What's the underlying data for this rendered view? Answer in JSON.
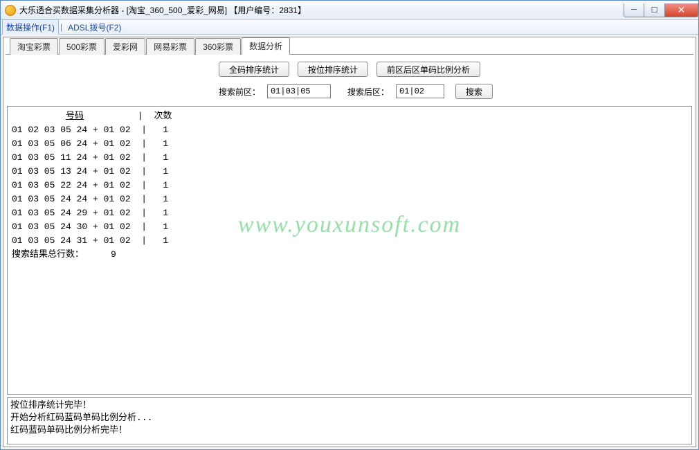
{
  "window": {
    "title": "大乐透合买数据采集分析器 - [淘宝_360_500_爱彩_网易]        【用户编号：2831】"
  },
  "menu": {
    "data_ops": "数据操作(F1)",
    "adsl": "ADSL拨号(F2)"
  },
  "tabs": {
    "taobao": "淘宝彩票",
    "c500": "500彩票",
    "aicai": "爱彩网",
    "wangyi": "网易彩票",
    "c360": "360彩票",
    "analysis": "数据分析"
  },
  "buttons": {
    "full_sort": "全码排序统计",
    "pos_sort": "按位排序统计",
    "ratio": "前区后区单码比例分析",
    "search": "搜索"
  },
  "labels": {
    "front": "搜索前区：",
    "back": "搜索后区："
  },
  "inputs": {
    "front": "01|03|05",
    "back": "01|02"
  },
  "headers": {
    "number": "号码",
    "count": "次数"
  },
  "rows": [
    {
      "code": "01 02 03 05 24 + 01 02",
      "count": "1"
    },
    {
      "code": "01 03 05 06 24 + 01 02",
      "count": "1"
    },
    {
      "code": "01 03 05 11 24 + 01 02",
      "count": "1"
    },
    {
      "code": "01 03 05 13 24 + 01 02",
      "count": "1"
    },
    {
      "code": "01 03 05 22 24 + 01 02",
      "count": "1"
    },
    {
      "code": "01 03 05 24 24 + 01 02",
      "count": "1"
    },
    {
      "code": "01 03 05 24 29 + 01 02",
      "count": "1"
    },
    {
      "code": "01 03 05 24 30 + 01 02",
      "count": "1"
    },
    {
      "code": "01 03 05 24 31 + 01 02",
      "count": "1"
    }
  ],
  "summary": {
    "label": "搜索结果总行数：",
    "value": "9"
  },
  "log": {
    "l1": "按位排序统计完毕！",
    "l2": "开始分析红码蓝码单码比例分析...",
    "l3": "红码蓝码单码比例分析完毕！"
  },
  "watermark": "www.youxunsoft.com"
}
